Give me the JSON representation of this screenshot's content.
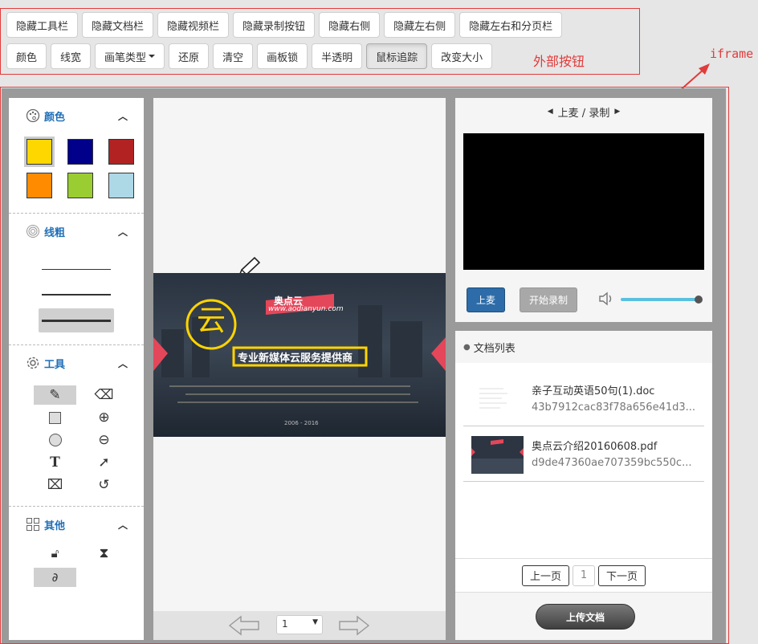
{
  "external": {
    "row1": [
      "隐藏工具栏",
      "隐藏文档栏",
      "隐藏视频栏",
      "隐藏录制按钮",
      "隐藏右侧",
      "隐藏左右侧",
      "隐藏左右和分页栏"
    ],
    "row2": [
      "颜色",
      "线宽",
      "画笔类型",
      "还原",
      "清空",
      "画板锁",
      "半透明",
      "鼠标追踪",
      "改变大小"
    ],
    "label": "外部按钮",
    "active": "鼠标追踪"
  },
  "iframe_label": "iframe",
  "tools": {
    "color": {
      "title": "颜色",
      "swatches": [
        "#ffd700",
        "#00008b",
        "#b22222",
        "#ff8c00",
        "#9acd32",
        "#add8e6"
      ],
      "selected": "#ffd700"
    },
    "width": {
      "title": "线粗"
    },
    "tool": {
      "title": "工具"
    },
    "other": {
      "title": "其他"
    }
  },
  "slide": {
    "brand": "奥点云",
    "url": "www.aodianyun.com",
    "logo_char": "云",
    "headline": "专业新媒体云服务提供商",
    "years": "2006 - 2016"
  },
  "board": {
    "page_select": "1"
  },
  "media": {
    "title": "上麦 / 录制",
    "mic_button": "上麦",
    "record_button": "开始录制",
    "volume": 1.0
  },
  "docs": {
    "header": "文档列表",
    "items": [
      {
        "name": "亲子互动英语50句(1).doc",
        "hash": "43b7912cac83f78a656e41d3..."
      },
      {
        "name": "奥点云介绍20160608.pdf",
        "hash": "d9de47360ae707359bc550c..."
      }
    ],
    "prev": "上一页",
    "page": "1",
    "next": "下一页",
    "upload": "上传文档"
  },
  "colors": {
    "accent": "#1f6fb8",
    "annotation": "#e23b3b"
  }
}
